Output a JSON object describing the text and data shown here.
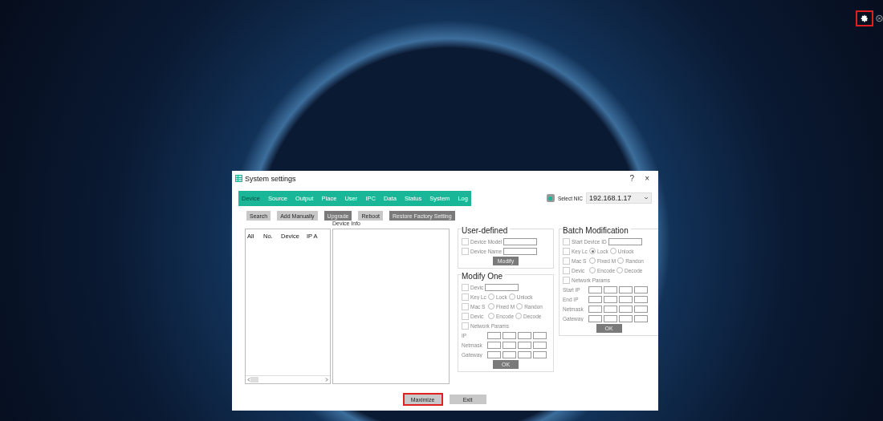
{
  "top_bar": {
    "settings_highlighted": true
  },
  "dialog": {
    "title": "System settings",
    "help": "?",
    "close": "×"
  },
  "tabs": [
    {
      "label": "Device",
      "selected": true
    },
    {
      "label": "Source",
      "selected": false
    },
    {
      "label": "Output",
      "selected": false
    },
    {
      "label": "Place",
      "selected": false
    },
    {
      "label": "User",
      "selected": false
    },
    {
      "label": "IPC",
      "selected": false
    },
    {
      "label": "Data",
      "selected": false
    },
    {
      "label": "Status",
      "selected": false
    },
    {
      "label": "System",
      "selected": false
    },
    {
      "label": "Log",
      "selected": false
    }
  ],
  "nic": {
    "label": "Select NIC",
    "value": "192.168.1.17"
  },
  "toolbar": [
    {
      "label": "Search",
      "kind": "light"
    },
    {
      "label": "Add Manually",
      "kind": "light"
    },
    {
      "label": "Upgrade",
      "kind": "dark"
    },
    {
      "label": "Reboot",
      "kind": "light"
    },
    {
      "label": "Restore Factory Setting",
      "kind": "dark"
    }
  ],
  "device_table": {
    "columns": [
      "All",
      "No.",
      "Device",
      "IP A"
    ]
  },
  "device_info": {
    "label": "Device Info"
  },
  "user_defined": {
    "title": "User-defined",
    "rows": [
      {
        "kind": "text",
        "label": "Device Model",
        "checked": false
      },
      {
        "kind": "text",
        "label": "Device Name",
        "checked": false
      }
    ],
    "button": "Modify"
  },
  "modify_one": {
    "title": "Modify One",
    "rows": [
      {
        "kind": "text",
        "label": "Devic",
        "checked": false
      },
      {
        "kind": "radio",
        "label": "Key Lc",
        "checked": false,
        "options": [
          {
            "label": "Lock",
            "selected": false
          },
          {
            "label": "Unlock",
            "selected": false
          }
        ]
      },
      {
        "kind": "radio",
        "label": "Mac S",
        "checked": false,
        "options": [
          {
            "label": "Fixed M",
            "selected": false
          },
          {
            "label": "Randon",
            "selected": false
          }
        ]
      },
      {
        "kind": "radio",
        "label": "Devic",
        "checked": false,
        "options": [
          {
            "label": "Encode",
            "selected": false
          },
          {
            "label": "Decode",
            "selected": false
          }
        ]
      },
      {
        "kind": "check",
        "label": "Network Params",
        "checked": false
      }
    ],
    "ip_rows": [
      "IP",
      "Netmask",
      "Gateway"
    ],
    "button": "OK"
  },
  "batch": {
    "title": "Batch Modification",
    "rows": [
      {
        "kind": "text",
        "label": "Start Device ID",
        "checked": false
      },
      {
        "kind": "radio",
        "label": "Key Lc",
        "checked": false,
        "options": [
          {
            "label": "Lock",
            "selected": true
          },
          {
            "label": "Unlock",
            "selected": false
          }
        ]
      },
      {
        "kind": "radio",
        "label": "Mac S",
        "checked": false,
        "options": [
          {
            "label": "Fixed M",
            "selected": false
          },
          {
            "label": "Randon",
            "selected": false
          }
        ]
      },
      {
        "kind": "radio",
        "label": "Devic",
        "checked": false,
        "options": [
          {
            "label": "Encode",
            "selected": false
          },
          {
            "label": "Decode",
            "selected": false
          }
        ]
      },
      {
        "kind": "check",
        "label": "Network Params",
        "checked": false
      }
    ],
    "ip_rows": [
      "Start IP",
      "End IP",
      "Netmask",
      "Gateway"
    ],
    "button": "OK"
  },
  "footer": [
    {
      "label": "Maximize",
      "highlighted": true
    },
    {
      "label": "Exit",
      "highlighted": false
    }
  ]
}
